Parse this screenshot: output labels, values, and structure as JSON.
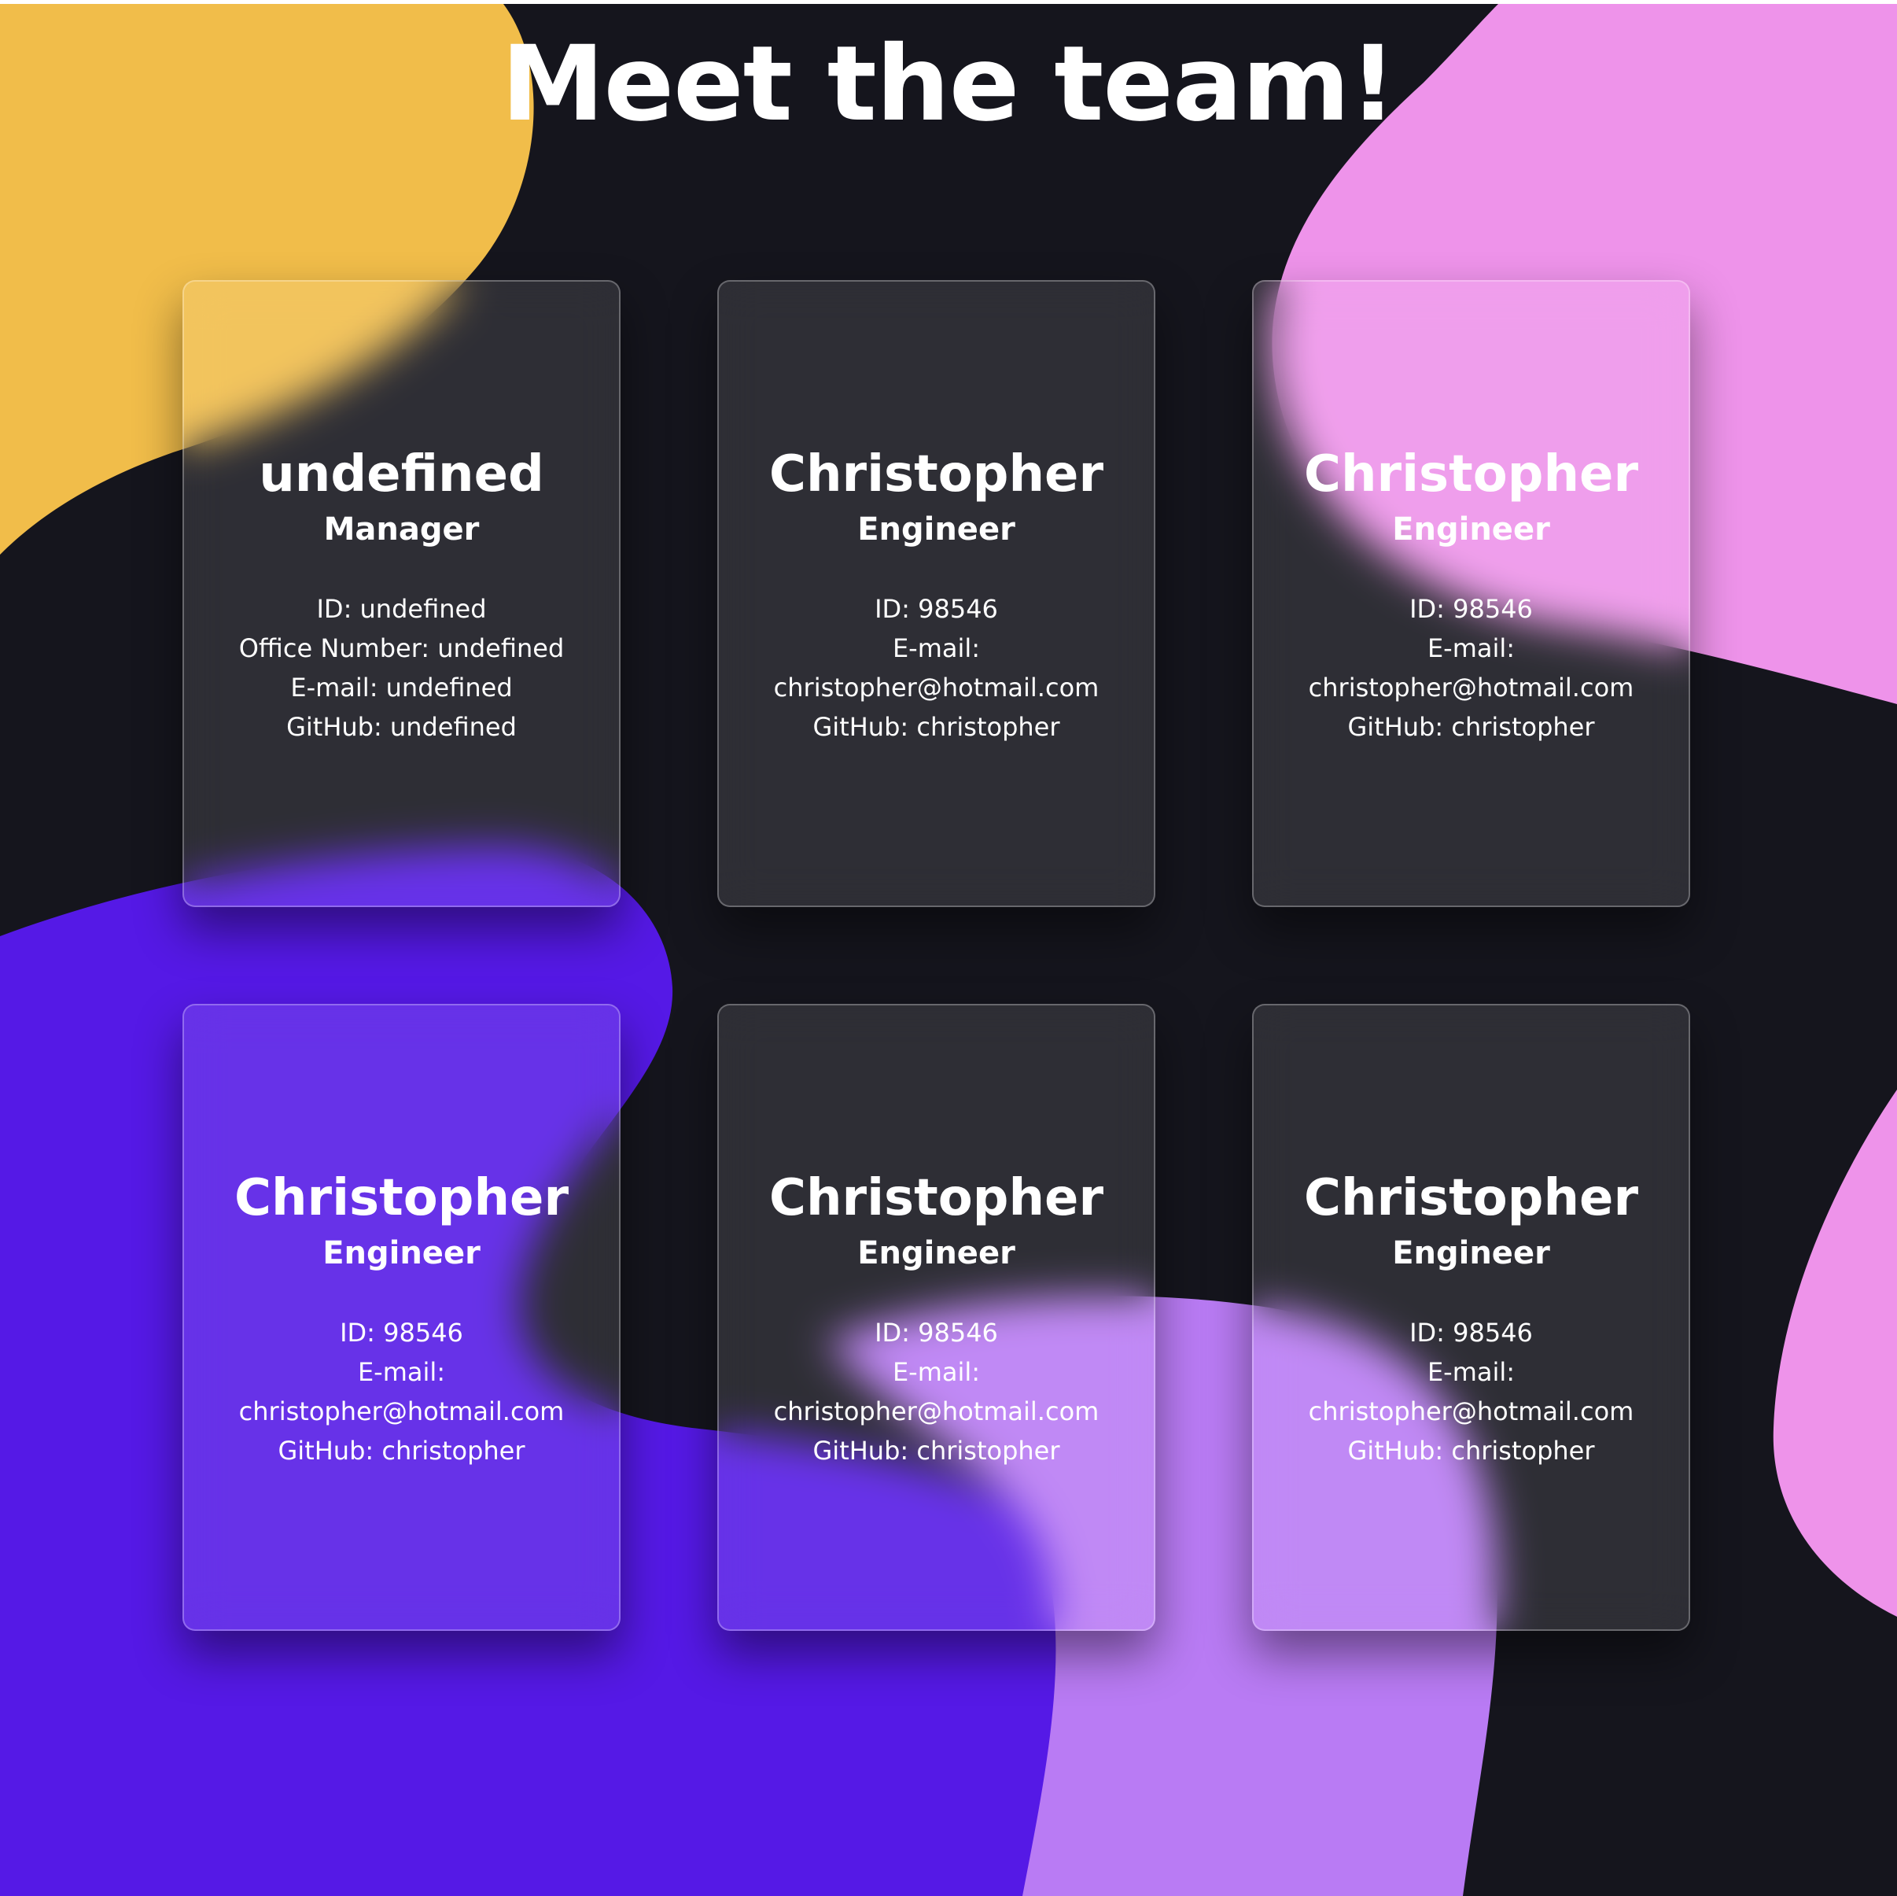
{
  "page": {
    "title": "Meet the team!"
  },
  "theme": {
    "background": "#15151d",
    "blob_yellow": "#f1bd4a",
    "blob_pink": "#ee93ea",
    "blob_indigo": "#5519e6",
    "blob_violet": "#b97bf4",
    "card_text": "#ffffff"
  },
  "cards": [
    {
      "name": "undefined",
      "role": "Manager",
      "lines": [
        "ID: undefined",
        "Office Number: undefined",
        "E-mail: undefined",
        "GitHub: undefined"
      ]
    },
    {
      "name": "Christopher",
      "role": "Engineer",
      "lines": [
        "ID: 98546",
        "E-mail:",
        "christopher@hotmail.com",
        "GitHub: christopher"
      ]
    },
    {
      "name": "Christopher",
      "role": "Engineer",
      "lines": [
        "ID: 98546",
        "E-mail:",
        "christopher@hotmail.com",
        "GitHub: christopher"
      ]
    },
    {
      "name": "Christopher",
      "role": "Engineer",
      "lines": [
        "ID: 98546",
        "E-mail:",
        "christopher@hotmail.com",
        "GitHub: christopher"
      ]
    },
    {
      "name": "Christopher",
      "role": "Engineer",
      "lines": [
        "ID: 98546",
        "E-mail:",
        "christopher@hotmail.com",
        "GitHub: christopher"
      ]
    },
    {
      "name": "Christopher",
      "role": "Engineer",
      "lines": [
        "ID: 98546",
        "E-mail:",
        "christopher@hotmail.com",
        "GitHub: christopher"
      ]
    }
  ]
}
